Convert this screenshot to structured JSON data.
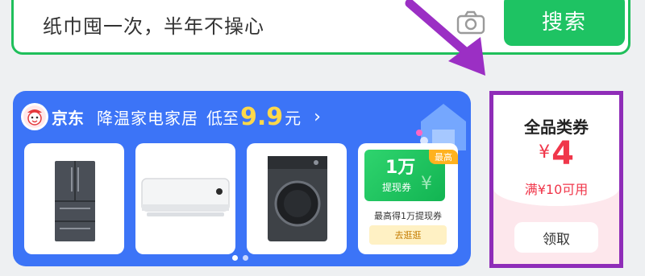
{
  "search": {
    "query_text": "纸巾囤一次，半年不操心",
    "button_label": "搜索",
    "accent_color": "#1ec363"
  },
  "promo": {
    "brand": "京东",
    "title": "降温家电家居",
    "low_prefix": "低至",
    "price": "9.9",
    "price_unit": "元",
    "chevron": "›",
    "background_color": "#3c74f7",
    "price_color": "#ffd84a",
    "tiles": [
      {
        "name": "refrigerator",
        "icon": "refrigerator-image"
      },
      {
        "name": "air-conditioner",
        "icon": "air-conditioner-image"
      },
      {
        "name": "washing-machine",
        "icon": "washing-machine-image"
      }
    ],
    "cash_tile": {
      "amount": "1万",
      "label": "提现券",
      "badge": "最高",
      "description": "最高得1万提现券",
      "button_label": "去逛逛"
    },
    "pagination": {
      "pages": 2,
      "active_index": 0
    }
  },
  "coupon": {
    "title": "全品类券",
    "currency": "¥",
    "amount": "4",
    "condition": "满¥10可用",
    "button_label": "领取",
    "highlight_color": "#8f2db8",
    "amount_color": "#f0364a"
  },
  "annotation": {
    "arrow_color": "#9b2fc4",
    "shape": "arrow-pointing-to-coupon"
  }
}
